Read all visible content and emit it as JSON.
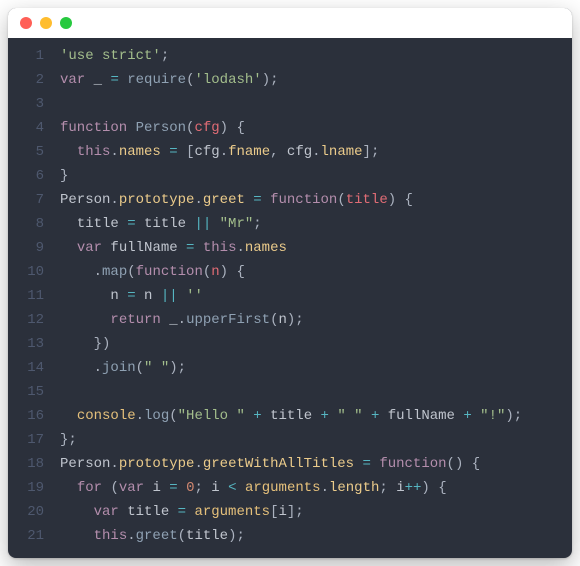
{
  "window": {
    "traffic_light_colors": {
      "close": "#ff5f56",
      "min": "#ffbd2e",
      "max": "#27c93f"
    }
  },
  "theme": {
    "bg": "#2b303b",
    "gutter": "#4e586e",
    "fg": "#c0c5ce",
    "kw": "#b48ead",
    "fn": "#8fa1b3",
    "str": "#a3be8c",
    "punc": "#abb2bf",
    "op": "#56b6c2",
    "num": "#d08770",
    "prop": "#ebcb8b",
    "param": "#e06c75",
    "builtin": "#e5c07b"
  },
  "code": {
    "lines": [
      [
        [
          "str",
          "'use strict'"
        ],
        [
          "punc",
          ";"
        ]
      ],
      [
        [
          "kw",
          "var"
        ],
        [
          "fg",
          " _ "
        ],
        [
          "op",
          "="
        ],
        [
          "fg",
          " "
        ],
        [
          "fn",
          "require"
        ],
        [
          "punc",
          "("
        ],
        [
          "str",
          "'lodash'"
        ],
        [
          "punc",
          ")"
        ],
        [
          "punc",
          ";"
        ]
      ],
      [],
      [
        [
          "kw",
          "function"
        ],
        [
          "fg",
          " "
        ],
        [
          "fn",
          "Person"
        ],
        [
          "punc",
          "("
        ],
        [
          "param",
          "cfg"
        ],
        [
          "punc",
          ")"
        ],
        [
          "fg",
          " "
        ],
        [
          "punc",
          "{"
        ]
      ],
      [
        [
          "fg",
          "  "
        ],
        [
          "kw",
          "this"
        ],
        [
          "punc",
          "."
        ],
        [
          "prop",
          "names"
        ],
        [
          "fg",
          " "
        ],
        [
          "op",
          "="
        ],
        [
          "fg",
          " "
        ],
        [
          "punc",
          "["
        ],
        [
          "fg",
          "cfg"
        ],
        [
          "punc",
          "."
        ],
        [
          "prop",
          "fname"
        ],
        [
          "punc",
          ","
        ],
        [
          "fg",
          " cfg"
        ],
        [
          "punc",
          "."
        ],
        [
          "prop",
          "lname"
        ],
        [
          "punc",
          "]"
        ],
        [
          "punc",
          ";"
        ]
      ],
      [
        [
          "punc",
          "}"
        ]
      ],
      [
        [
          "fg",
          "Person"
        ],
        [
          "punc",
          "."
        ],
        [
          "prop",
          "prototype"
        ],
        [
          "punc",
          "."
        ],
        [
          "prop",
          "greet"
        ],
        [
          "fg",
          " "
        ],
        [
          "op",
          "="
        ],
        [
          "fg",
          " "
        ],
        [
          "kw",
          "function"
        ],
        [
          "punc",
          "("
        ],
        [
          "param",
          "title"
        ],
        [
          "punc",
          ")"
        ],
        [
          "fg",
          " "
        ],
        [
          "punc",
          "{"
        ]
      ],
      [
        [
          "fg",
          "  title "
        ],
        [
          "op",
          "="
        ],
        [
          "fg",
          " title "
        ],
        [
          "op",
          "||"
        ],
        [
          "fg",
          " "
        ],
        [
          "str",
          "\"Mr\""
        ],
        [
          "punc",
          ";"
        ]
      ],
      [
        [
          "fg",
          "  "
        ],
        [
          "kw",
          "var"
        ],
        [
          "fg",
          " fullName "
        ],
        [
          "op",
          "="
        ],
        [
          "fg",
          " "
        ],
        [
          "kw",
          "this"
        ],
        [
          "punc",
          "."
        ],
        [
          "prop",
          "names"
        ]
      ],
      [
        [
          "fg",
          "    "
        ],
        [
          "punc",
          "."
        ],
        [
          "fn",
          "map"
        ],
        [
          "punc",
          "("
        ],
        [
          "kw",
          "function"
        ],
        [
          "punc",
          "("
        ],
        [
          "param",
          "n"
        ],
        [
          "punc",
          ")"
        ],
        [
          "fg",
          " "
        ],
        [
          "punc",
          "{"
        ]
      ],
      [
        [
          "fg",
          "      n "
        ],
        [
          "op",
          "="
        ],
        [
          "fg",
          " n "
        ],
        [
          "op",
          "||"
        ],
        [
          "fg",
          " "
        ],
        [
          "str",
          "''"
        ]
      ],
      [
        [
          "fg",
          "      "
        ],
        [
          "kw",
          "return"
        ],
        [
          "fg",
          " _"
        ],
        [
          "punc",
          "."
        ],
        [
          "fn",
          "upperFirst"
        ],
        [
          "punc",
          "("
        ],
        [
          "fg",
          "n"
        ],
        [
          "punc",
          ")"
        ],
        [
          "punc",
          ";"
        ]
      ],
      [
        [
          "fg",
          "    "
        ],
        [
          "punc",
          "}"
        ],
        [
          "punc",
          ")"
        ]
      ],
      [
        [
          "fg",
          "    "
        ],
        [
          "punc",
          "."
        ],
        [
          "fn",
          "join"
        ],
        [
          "punc",
          "("
        ],
        [
          "str",
          "\" \""
        ],
        [
          "punc",
          ")"
        ],
        [
          "punc",
          ";"
        ]
      ],
      [],
      [
        [
          "fg",
          "  "
        ],
        [
          "builtin",
          "console"
        ],
        [
          "punc",
          "."
        ],
        [
          "fn",
          "log"
        ],
        [
          "punc",
          "("
        ],
        [
          "str",
          "\"Hello \""
        ],
        [
          "fg",
          " "
        ],
        [
          "op",
          "+"
        ],
        [
          "fg",
          " title "
        ],
        [
          "op",
          "+"
        ],
        [
          "fg",
          " "
        ],
        [
          "str",
          "\" \""
        ],
        [
          "fg",
          " "
        ],
        [
          "op",
          "+"
        ],
        [
          "fg",
          " fullName "
        ],
        [
          "op",
          "+"
        ],
        [
          "fg",
          " "
        ],
        [
          "str",
          "\"!\""
        ],
        [
          "punc",
          ")"
        ],
        [
          "punc",
          ";"
        ]
      ],
      [
        [
          "punc",
          "}"
        ],
        [
          "punc",
          ";"
        ]
      ],
      [
        [
          "fg",
          "Person"
        ],
        [
          "punc",
          "."
        ],
        [
          "prop",
          "prototype"
        ],
        [
          "punc",
          "."
        ],
        [
          "prop",
          "greetWithAllTitles"
        ],
        [
          "fg",
          " "
        ],
        [
          "op",
          "="
        ],
        [
          "fg",
          " "
        ],
        [
          "kw",
          "function"
        ],
        [
          "punc",
          "("
        ],
        [
          "punc",
          ")"
        ],
        [
          "fg",
          " "
        ],
        [
          "punc",
          "{"
        ]
      ],
      [
        [
          "fg",
          "  "
        ],
        [
          "kw",
          "for"
        ],
        [
          "fg",
          " "
        ],
        [
          "punc",
          "("
        ],
        [
          "kw",
          "var"
        ],
        [
          "fg",
          " i "
        ],
        [
          "op",
          "="
        ],
        [
          "fg",
          " "
        ],
        [
          "num",
          "0"
        ],
        [
          "punc",
          ";"
        ],
        [
          "fg",
          " i "
        ],
        [
          "op",
          "<"
        ],
        [
          "fg",
          " "
        ],
        [
          "builtin",
          "arguments"
        ],
        [
          "punc",
          "."
        ],
        [
          "prop",
          "length"
        ],
        [
          "punc",
          ";"
        ],
        [
          "fg",
          " i"
        ],
        [
          "op",
          "++"
        ],
        [
          "punc",
          ")"
        ],
        [
          "fg",
          " "
        ],
        [
          "punc",
          "{"
        ]
      ],
      [
        [
          "fg",
          "    "
        ],
        [
          "kw",
          "var"
        ],
        [
          "fg",
          " title "
        ],
        [
          "op",
          "="
        ],
        [
          "fg",
          " "
        ],
        [
          "builtin",
          "arguments"
        ],
        [
          "punc",
          "["
        ],
        [
          "fg",
          "i"
        ],
        [
          "punc",
          "]"
        ],
        [
          "punc",
          ";"
        ]
      ],
      [
        [
          "fg",
          "    "
        ],
        [
          "kw",
          "this"
        ],
        [
          "punc",
          "."
        ],
        [
          "fn",
          "greet"
        ],
        [
          "punc",
          "("
        ],
        [
          "fg",
          "title"
        ],
        [
          "punc",
          ")"
        ],
        [
          "punc",
          ";"
        ]
      ]
    ]
  }
}
